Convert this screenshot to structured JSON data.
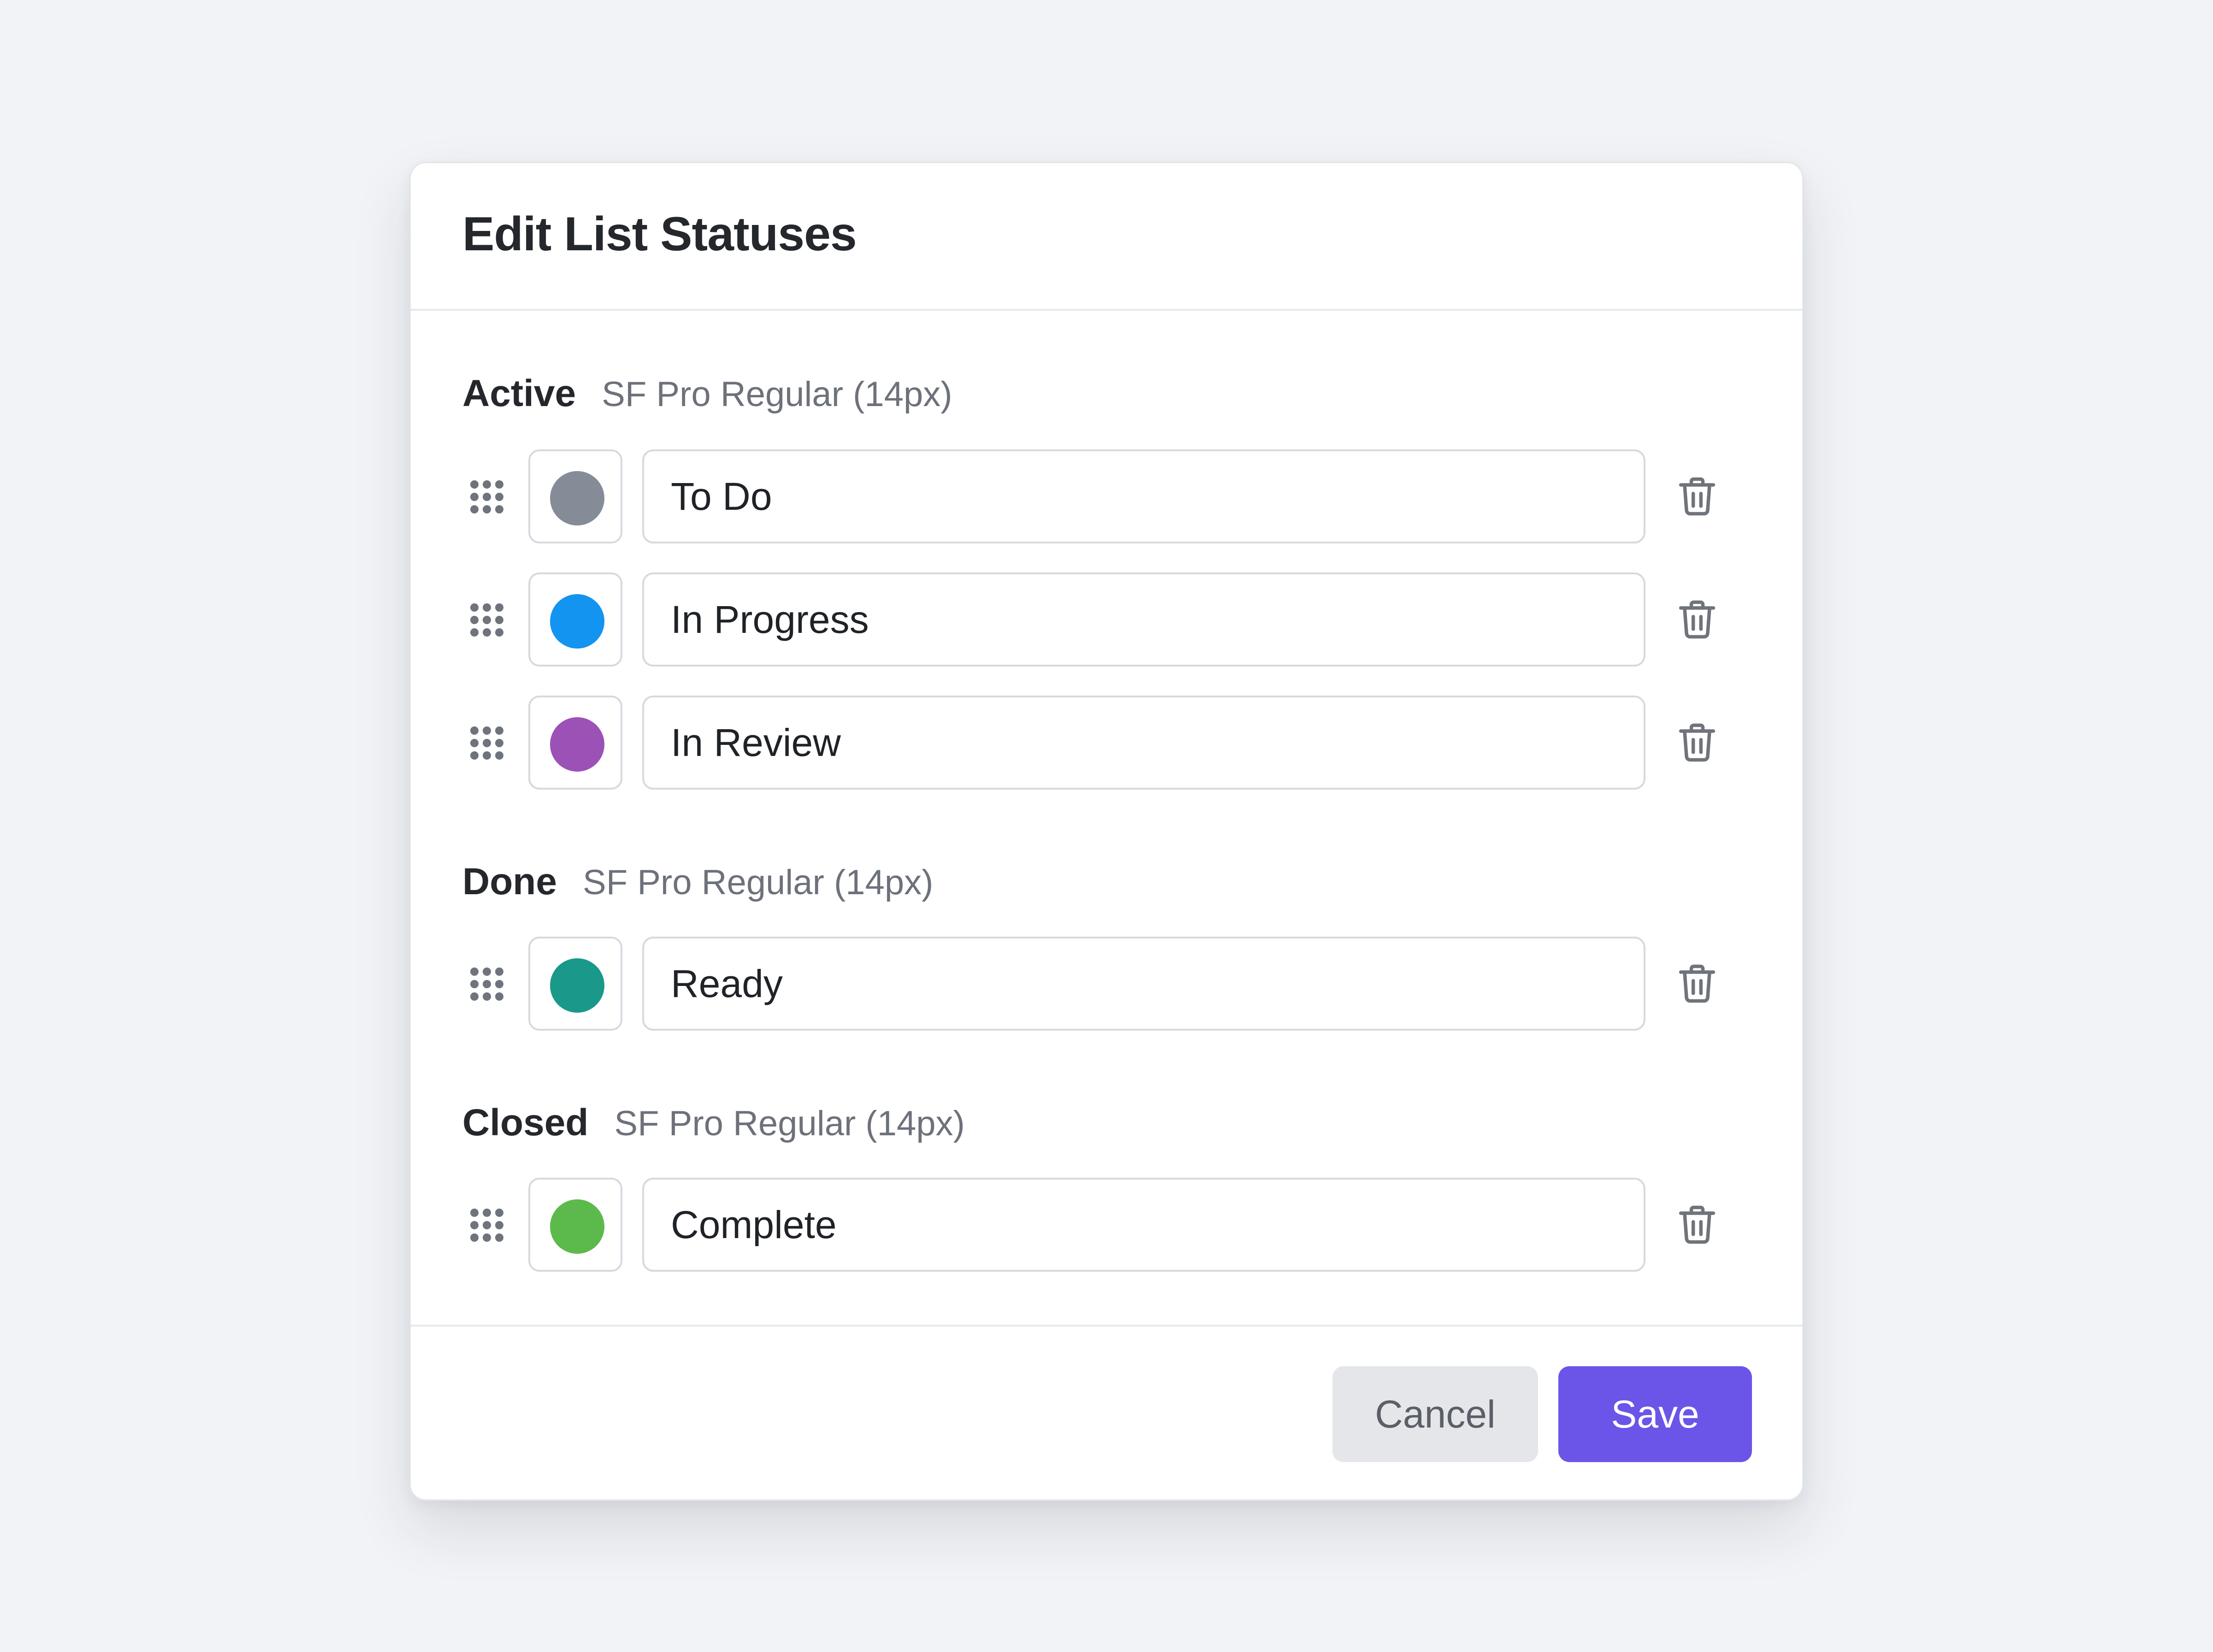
{
  "dialog": {
    "title": "Edit List Statuses"
  },
  "groups": [
    {
      "name": "Active",
      "font_label": "SF Pro Regular (14px)",
      "statuses": [
        {
          "name": "To Do",
          "color": "#868c97"
        },
        {
          "name": "In Progress",
          "color": "#1394f0"
        },
        {
          "name": "In Review",
          "color": "#9c51b6"
        }
      ]
    },
    {
      "name": "Done",
      "font_label": "SF Pro Regular (14px)",
      "statuses": [
        {
          "name": "Ready",
          "color": "#1a9889"
        }
      ]
    },
    {
      "name": "Closed",
      "font_label": "SF Pro Regular (14px)",
      "statuses": [
        {
          "name": "Complete",
          "color": "#5cba4c"
        }
      ]
    }
  ],
  "icons": {
    "drag": "drag-handle-icon",
    "delete": "trash-icon"
  },
  "footer": {
    "cancel_label": "Cancel",
    "save_label": "Save"
  },
  "colors": {
    "accent": "#6a55e8",
    "background": "#f1f3f6"
  }
}
